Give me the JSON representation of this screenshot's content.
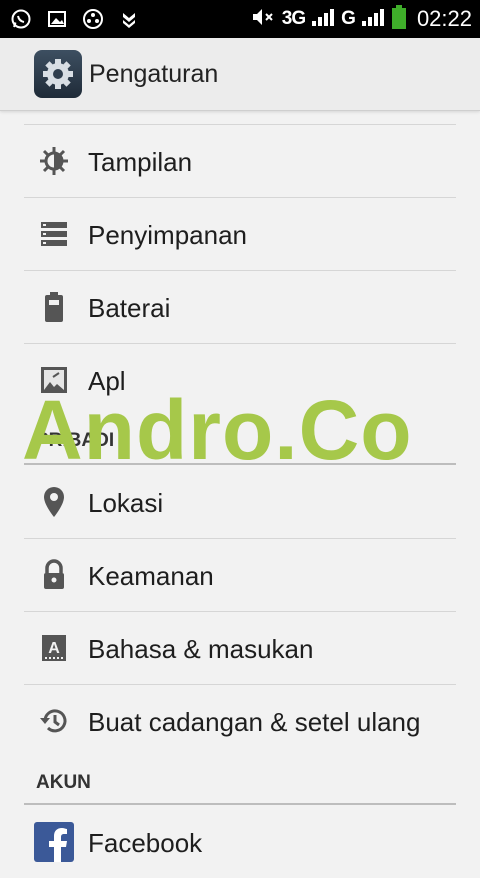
{
  "status_bar": {
    "left_icons": [
      "whatsapp-icon",
      "gallery-icon",
      "media-icon",
      "download-icon"
    ],
    "network_1": "3G",
    "network_2": "G",
    "time": "02:22"
  },
  "action_bar": {
    "title": "Pengaturan",
    "icon": "gear-icon"
  },
  "device_items": [
    {
      "label": "Tampilan",
      "icon": "display-brightness-icon"
    },
    {
      "label": "Penyimpanan",
      "icon": "storage-icon"
    },
    {
      "label": "Baterai",
      "icon": "battery-icon"
    },
    {
      "label": "Apl",
      "icon": "apps-icon"
    }
  ],
  "personal_header": "PRIBADI",
  "personal_items": [
    {
      "label": "Lokasi",
      "icon": "location-pin-icon"
    },
    {
      "label": "Keamanan",
      "icon": "lock-icon"
    },
    {
      "label": "Bahasa & masukan",
      "icon": "language-input-icon"
    },
    {
      "label": "Buat cadangan & setel ulang",
      "icon": "backup-restore-icon"
    }
  ],
  "accounts_header": "AKUN",
  "account_items": [
    {
      "label": "Facebook",
      "icon": "facebook-icon"
    }
  ],
  "watermark": "Andro.Co",
  "colors": {
    "watermark": "#a6c84a",
    "background": "#f2f2f2",
    "facebook": "#3b5998",
    "battery": "#3fae2a"
  }
}
